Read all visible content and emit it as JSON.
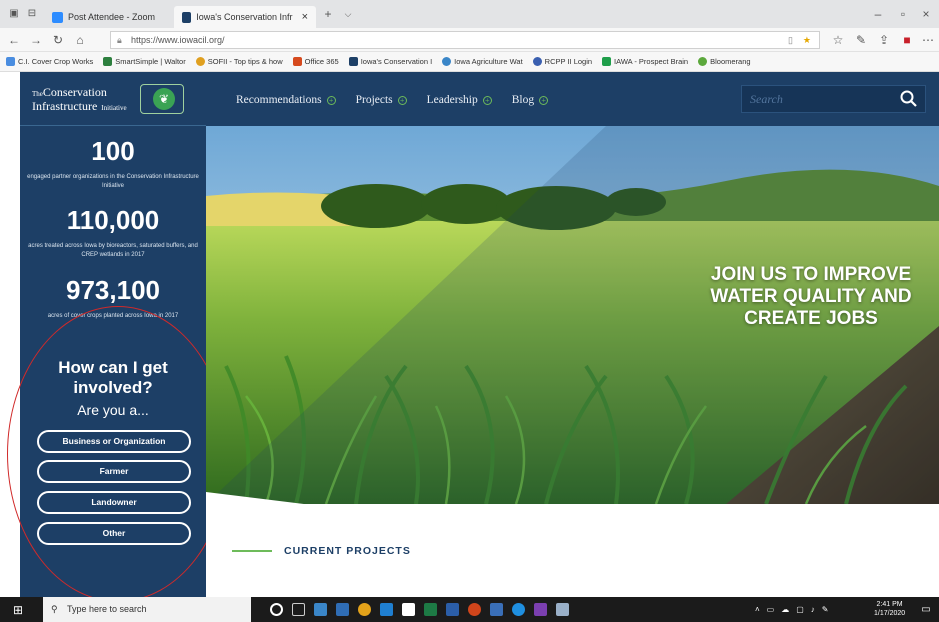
{
  "browser": {
    "tabs": [
      {
        "label": "Post Attendee - Zoom",
        "close": ""
      },
      {
        "label": "Iowa's Conservation Infr",
        "close": "×"
      }
    ],
    "new_tab": "+",
    "tab_menu": "⌵",
    "window_controls": {
      "minimize": "–",
      "restore": "▫",
      "close": "×"
    },
    "url": "https://www.iowacil.org/",
    "bookmarks": [
      "C.I. Cover Crop Works",
      "SmartSimple | Waltor",
      "SOFII - Top tips & how",
      "Office 365",
      "Iowa's Conservation I",
      "Iowa Agriculture Wat",
      "RCPP II Login",
      "IAWA - Prospect Brain",
      "Bloomerang"
    ],
    "accent_colors": [
      "#4a8de0",
      "#2d7f3e",
      "#e0a020",
      "#d64a1e",
      "#1d3f66",
      "#3a86c8",
      "#3a5fb0",
      "#1f9e4a",
      "#5ca83c"
    ]
  },
  "site": {
    "logo": {
      "small": "The",
      "line1": "Conservation",
      "line2": "Infrastructure",
      "small2": "Initiative"
    },
    "menu": [
      "Recommendations",
      "Projects",
      "Leadership",
      "Blog"
    ],
    "search_placeholder": "Search",
    "stats": [
      {
        "number": "100",
        "desc": "engaged partner organizations in the Conservation Infrastructure Initiative"
      },
      {
        "number": "110,000",
        "desc": "acres treated across Iowa by bioreactors, saturated buffers, and CREP wetlands in 2017"
      },
      {
        "number": "973,100",
        "desc": "acres of cover crops planted across Iowa in 2017"
      }
    ],
    "involve_heading": "How can I get involved?",
    "involve_sub": "Are you a...",
    "buttons": [
      "Business or Organization",
      "Farmer",
      "Landowner",
      "Other"
    ],
    "hero_heading": "JOIN US TO IMPROVE WATER QUALITY AND CREATE JOBS",
    "section_label": "CURRENT PROJECTS",
    "colors": {
      "navy": "#1d3f66",
      "green": "#6dbb5a",
      "annotation": "#d02a2a"
    }
  },
  "taskbar": {
    "search_placeholder": "Type here to search",
    "time": "2:41 PM",
    "date": "1/17/2020"
  }
}
